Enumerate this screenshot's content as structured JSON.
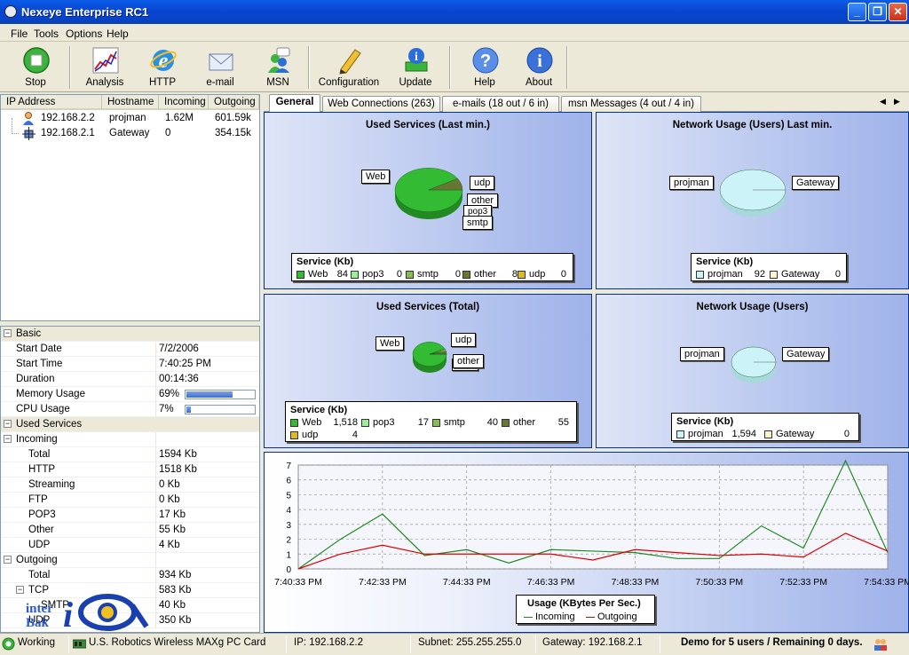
{
  "window": {
    "title": "Nexeye Enterprise RC1"
  },
  "menu": [
    "File",
    "Tools",
    "Options",
    "Help"
  ],
  "toolbar": {
    "stop": "Stop",
    "analysis": "Analysis",
    "http": "HTTP",
    "email": "e-mail",
    "msn": "MSN",
    "configuration": "Configuration",
    "update": "Update",
    "help": "Help",
    "about": "About"
  },
  "hosts": {
    "columns": [
      "IP Address",
      "Hostname",
      "Incoming",
      "Outgoing"
    ],
    "rows": [
      {
        "ip": "192.168.2.2",
        "host": "projman",
        "in": "1.62M",
        "out": "601.59k"
      },
      {
        "ip": "192.168.2.1",
        "host": "Gateway",
        "in": "0",
        "out": "354.15k"
      }
    ]
  },
  "props": {
    "basic": "Basic",
    "start_date_k": "Start Date",
    "start_date": "7/2/2006",
    "start_time_k": "Start Time",
    "start_time": "7:40:25 PM",
    "duration_k": "Duration",
    "duration": "00:14:36",
    "memory_k": "Memory Usage",
    "memory": "69%",
    "memory_level": 0.69,
    "cpu_k": "CPU Usage",
    "cpu": "7%",
    "cpu_level": 0.07,
    "used_services": "Used Services",
    "incoming": "Incoming",
    "in_total_k": "Total",
    "in_total": "1594 Kb",
    "http_k": "HTTP",
    "http": "1518 Kb",
    "streaming_k": "Streaming",
    "streaming": "0 Kb",
    "ftp_k": "FTP",
    "ftp": "0 Kb",
    "pop3_k": "POP3",
    "pop3": "17 Kb",
    "other_k": "Other",
    "other": "55 Kb",
    "udp_k": "UDP",
    "udp": "4 Kb",
    "outgoing": "Outgoing",
    "out_total_k": "Total",
    "out_total": "934 Kb",
    "tcp_k": "TCP",
    "tcp": "583 Kb",
    "smtp_k": "SMTP",
    "smtp": "40 Kb",
    "udp2_k": "UDP",
    "udp2": "350 Kb"
  },
  "watermark": "interBak",
  "tabs": [
    "General",
    "Web Connections (263)",
    "e-mails (18 out / 6 in)",
    "msn Messages (4 out / 4 in)"
  ],
  "colors": {
    "web": "#33bb33",
    "pop3": "#99ee99",
    "smtp": "#88bb55",
    "other": "#667733",
    "udp": "#ddbb22",
    "projman": "#ccf4f8",
    "gateway": "#fff4d0",
    "incoming": "#228822",
    "outgoing": "#dd0000"
  },
  "charts": {
    "p1": {
      "title": "Used Services (Last min.)",
      "legend_title": "Service (Kb)",
      "labels": [
        "Web",
        "udp",
        "other",
        "pop3",
        "smtp"
      ],
      "items": [
        {
          "name": "Web",
          "value": "84"
        },
        {
          "name": "pop3",
          "value": "0"
        },
        {
          "name": "smtp",
          "value": "0"
        },
        {
          "name": "other",
          "value": "8"
        },
        {
          "name": "udp",
          "value": "0"
        }
      ]
    },
    "p2": {
      "title": "Network Usage (Users) Last min.",
      "legend_title": "Service (Kb)",
      "labels": [
        "projman",
        "Gateway"
      ],
      "items": [
        {
          "name": "projman",
          "value": "92"
        },
        {
          "name": "Gateway",
          "value": "0"
        }
      ]
    },
    "p3": {
      "title": "Used Services (Total)",
      "legend_title": "Service (Kb)",
      "labels": [
        "Web",
        "udp",
        "other",
        "pop3"
      ],
      "items": [
        {
          "name": "Web",
          "value": "1,518"
        },
        {
          "name": "pop3",
          "value": "17"
        },
        {
          "name": "smtp",
          "value": "40"
        },
        {
          "name": "other",
          "value": "55"
        },
        {
          "name": "udp",
          "value": "4"
        }
      ]
    },
    "p4": {
      "title": "Network Usage (Users)",
      "legend_title": "Service (Kb)",
      "labels": [
        "projman",
        "Gateway"
      ],
      "items": [
        {
          "name": "projman",
          "value": "1,594"
        },
        {
          "name": "Gateway",
          "value": "0"
        }
      ]
    },
    "line": {
      "legend_title": "Usage (KBytes Per Sec.)",
      "series_names": [
        "Incoming",
        "Outgoing"
      ]
    }
  },
  "chart_data": [
    {
      "type": "pie",
      "title": "Used Services (Last min.)",
      "categories": [
        "Web",
        "pop3",
        "smtp",
        "other",
        "udp"
      ],
      "values": [
        84,
        0,
        0,
        8,
        0
      ]
    },
    {
      "type": "pie",
      "title": "Network Usage (Users) Last min.",
      "categories": [
        "projman",
        "Gateway"
      ],
      "values": [
        92,
        0
      ]
    },
    {
      "type": "pie",
      "title": "Used Services (Total)",
      "categories": [
        "Web",
        "pop3",
        "smtp",
        "other",
        "udp"
      ],
      "values": [
        1518,
        17,
        40,
        55,
        4
      ]
    },
    {
      "type": "pie",
      "title": "Network Usage (Users)",
      "categories": [
        "projman",
        "Gateway"
      ],
      "values": [
        1594,
        0
      ]
    },
    {
      "type": "line",
      "title": "Usage (KBytes Per Sec.)",
      "ylim": [
        0,
        7
      ],
      "yticks": [
        0,
        1,
        2,
        3,
        4,
        5,
        6,
        7
      ],
      "xticks": [
        "7:40:33 PM",
        "7:42:33 PM",
        "7:44:33 PM",
        "7:46:33 PM",
        "7:48:33 PM",
        "7:50:33 PM",
        "7:52:33 PM",
        "7:54:33 PM"
      ],
      "x": [
        "7:40:33 PM",
        "7:41:33 PM",
        "7:42:33 PM",
        "7:43:33 PM",
        "7:44:33 PM",
        "7:45:33 PM",
        "7:46:33 PM",
        "7:47:33 PM",
        "7:48:33 PM",
        "7:49:33 PM",
        "7:50:33 PM",
        "7:51:33 PM",
        "7:52:33 PM",
        "7:53:33 PM",
        "7:54:33 PM"
      ],
      "series": [
        {
          "name": "Incoming",
          "values": [
            0,
            2.0,
            3.7,
            0.9,
            1.3,
            0.4,
            1.3,
            1.2,
            1.1,
            0.7,
            0.7,
            2.9,
            1.4,
            7.3,
            1.1
          ]
        },
        {
          "name": "Outgoing",
          "values": [
            0,
            1.0,
            1.6,
            1.0,
            1.0,
            1.0,
            1.0,
            0.6,
            1.3,
            1.1,
            0.9,
            1.0,
            0.8,
            2.4,
            1.2
          ]
        }
      ]
    }
  ],
  "status": {
    "state": "Working",
    "adapter": "U.S. Robotics Wireless MAXg PC Card",
    "ip": "IP: 192.168.2.2",
    "subnet": "Subnet: 255.255.255.0",
    "gateway": "Gateway: 192.168.2.1",
    "demo": "Demo for 5 users / Remaining 0 days."
  }
}
